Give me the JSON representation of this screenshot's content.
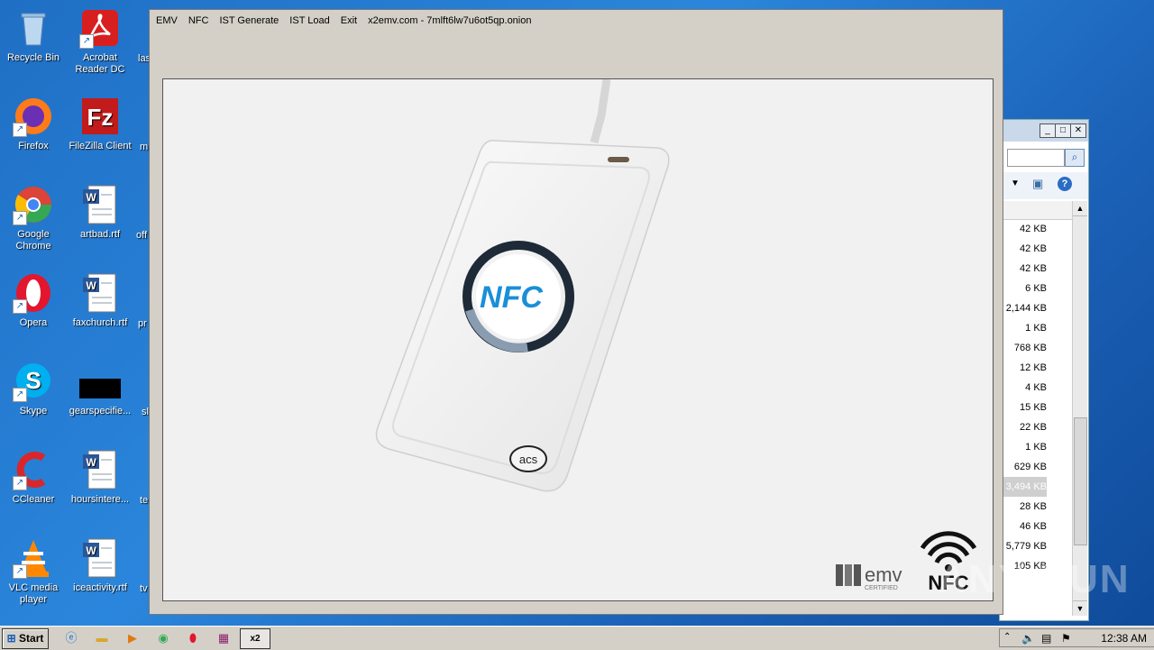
{
  "desktop": {
    "icons": [
      {
        "label": "Recycle Bin",
        "icon": "recycle-bin-icon",
        "color": "#6fa8dc"
      },
      {
        "label": "Acrobat Reader DC",
        "icon": "acrobat-icon",
        "color": "#d71f1f"
      },
      {
        "label": "Firefox",
        "icon": "firefox-icon",
        "color": "#ff7b1a"
      },
      {
        "label": "FileZilla Client",
        "icon": "filezilla-icon",
        "color": "#c21b1b"
      },
      {
        "label": "Google Chrome",
        "icon": "chrome-icon",
        "color": "#34a853"
      },
      {
        "label": "artbad.rtf",
        "icon": "word-doc-icon",
        "color": "#2b5797"
      },
      {
        "label": "Opera",
        "icon": "opera-icon",
        "color": "#e3162d"
      },
      {
        "label": "faxchurch.rtf",
        "icon": "word-doc-icon",
        "color": "#2b5797"
      },
      {
        "label": "Skype",
        "icon": "skype-icon",
        "color": "#00aff0"
      },
      {
        "label": "gearspecifie...",
        "icon": "black-file-icon",
        "color": "#000000"
      },
      {
        "label": "CCleaner",
        "icon": "ccleaner-icon",
        "color": "#d9262a"
      },
      {
        "label": "hoursintere...",
        "icon": "word-doc-icon",
        "color": "#2b5797"
      },
      {
        "label": "VLC media player",
        "icon": "vlc-icon",
        "color": "#ff8800"
      },
      {
        "label": "iceactivity.rtf",
        "icon": "word-doc-icon",
        "color": "#2b5797"
      }
    ],
    "partial_labels": [
      "las",
      "m",
      "off",
      "pr",
      "sl",
      "te",
      "tv"
    ]
  },
  "explorer": {
    "sizes": [
      "42 KB",
      "42 KB",
      "42 KB",
      "6 KB",
      "2,144 KB",
      "1 KB",
      "768 KB",
      "12 KB",
      "4 KB",
      "15 KB",
      "22 KB",
      "1 KB",
      "629 KB",
      "3,494 KB",
      "28 KB",
      "46 KB",
      "5,779 KB",
      "105 KB"
    ],
    "selected_index": 13
  },
  "app": {
    "menu": [
      "EMV",
      "NFC",
      "IST Generate",
      "IST Load",
      "Exit"
    ],
    "title": "x2emv.com - 7mlft6lw7u6ot5qp.onion",
    "device": {
      "logo_text": "NFC",
      "brand": "acs"
    },
    "badges": {
      "emv_text": "emv",
      "emv_sub": "CERTIFIED",
      "nfc_text": "NFC"
    }
  },
  "taskbar": {
    "start_label": "Start",
    "active_task_label": "x2",
    "clock": "12:38 AM"
  },
  "watermark": "ANY RUN"
}
